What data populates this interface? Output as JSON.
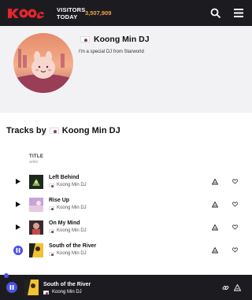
{
  "header": {
    "logo_text": "KOONG",
    "visitors_label_line1": "VISITORS",
    "visitors_label_line2": "TODAY",
    "visitors_count": "3,507,909",
    "accent": "#f2a444",
    "bg": "#1c1c20"
  },
  "profile": {
    "name": "Koong Min DJ",
    "description": "I'm a special DJ from Starworld",
    "flag": "south-korea-flag-icon"
  },
  "tracks_section": {
    "heading_prefix": "Tracks by",
    "heading_artist": "Koong Min DJ",
    "column_title": "TITLE",
    "column_artist": "artist"
  },
  "tracks": [
    {
      "title": "Left Behind",
      "artist": "Koong Min DJ",
      "playing": false
    },
    {
      "title": "Rise Up",
      "artist": "Koong Min DJ",
      "playing": false
    },
    {
      "title": "On My Mind",
      "artist": "Koong Min DJ",
      "playing": false
    },
    {
      "title": "South of the River",
      "artist": "Koong Min DJ",
      "playing": true
    }
  ],
  "player": {
    "title": "South of the River",
    "artist": "Koong Min DJ",
    "accent": "#4a52e6"
  }
}
